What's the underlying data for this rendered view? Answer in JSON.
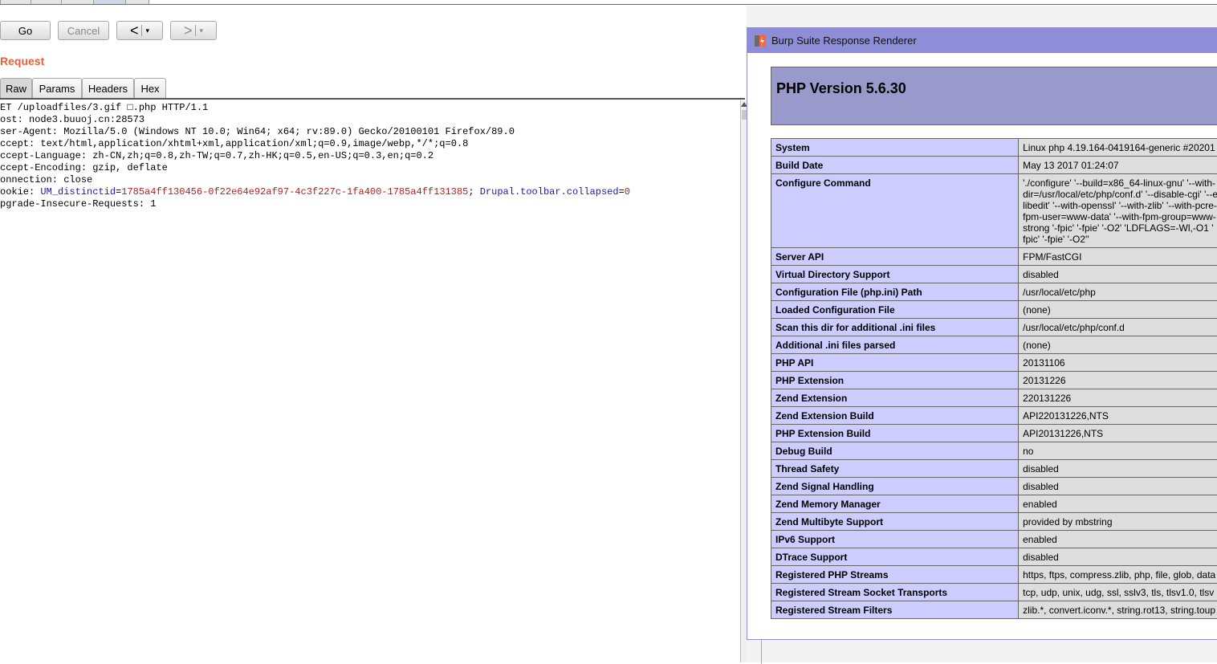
{
  "toolbar": {
    "go_label": "Go",
    "cancel_label": "Cancel",
    "back_arrow": "<",
    "forward_arrow": ">",
    "dropdown_glyph": "▾"
  },
  "request": {
    "title": "Request",
    "tabs": [
      "Raw",
      "Params",
      "Headers",
      "Hex"
    ],
    "active_tab": "Raw",
    "lines": [
      "ET /uploadfiles/3.gif □.php HTTP/1.1",
      "ost: node3.buuoj.cn:28573",
      "ser-Agent: Mozilla/5.0 (Windows NT 10.0; Win64; x64; rv:89.0) Gecko/20100101 Firefox/89.0",
      "ccept: text/html,application/xhtml+xml,application/xml;q=0.9,image/webp,*/*;q=0.8",
      "ccept-Language: zh-CN,zh;q=0.8,zh-TW;q=0.7,zh-HK;q=0.5,en-US;q=0.3,en;q=0.2",
      "ccept-Encoding: gzip, deflate",
      "onnection: close"
    ],
    "cookie_line": {
      "prefix": "ookie: ",
      "name1": "UM_distinctid",
      "eq1": "=",
      "value1": "1785a4ff130456-0f22e64e92af97-4c3f227c-1fa400-1785a4ff131385",
      "sep": "; ",
      "name2": "Drupal.toolbar.collapsed",
      "eq2": "=",
      "value2": "0"
    },
    "last_line": "pgrade-Insecure-Requests: 1"
  },
  "renderer": {
    "window_title": "Burp Suite Response Renderer",
    "php_version": "PHP Version 5.6.30",
    "rows": [
      {
        "key": "System",
        "value": "Linux php 4.19.164-0419164-generic #20201"
      },
      {
        "key": "Build Date",
        "value": "May 13 2017 01:24:07"
      },
      {
        "key": "Configure Command",
        "value": "'./configure' '--build=x86_64-linux-gnu' '--with-dir=/usr/local/etc/php/conf.d' '--disable-cgi' '--e libedit' '--with-openssl' '--with-zlib' '--with-pcre-fpm-user=www-data' '--with-fpm-group=www-strong '-fpic' '-fpie' '-O2' 'LDFLAGS=-Wl,-O1 ' fpic' '-fpie' '-O2''"
      },
      {
        "key": "Server API",
        "value": "FPM/FastCGI"
      },
      {
        "key": "Virtual Directory Support",
        "value": "disabled"
      },
      {
        "key": "Configuration File (php.ini) Path",
        "value": "/usr/local/etc/php"
      },
      {
        "key": "Loaded Configuration File",
        "value": "(none)"
      },
      {
        "key": "Scan this dir for additional .ini files",
        "value": "/usr/local/etc/php/conf.d"
      },
      {
        "key": "Additional .ini files parsed",
        "value": "(none)"
      },
      {
        "key": "PHP API",
        "value": "20131106"
      },
      {
        "key": "PHP Extension",
        "value": "20131226"
      },
      {
        "key": "Zend Extension",
        "value": "220131226"
      },
      {
        "key": "Zend Extension Build",
        "value": "API220131226,NTS"
      },
      {
        "key": "PHP Extension Build",
        "value": "API20131226,NTS"
      },
      {
        "key": "Debug Build",
        "value": "no"
      },
      {
        "key": "Thread Safety",
        "value": "disabled"
      },
      {
        "key": "Zend Signal Handling",
        "value": "disabled"
      },
      {
        "key": "Zend Memory Manager",
        "value": "enabled"
      },
      {
        "key": "Zend Multibyte Support",
        "value": "provided by mbstring"
      },
      {
        "key": "IPv6 Support",
        "value": "enabled"
      },
      {
        "key": "DTrace Support",
        "value": "disabled"
      },
      {
        "key": "Registered PHP Streams",
        "value": "https, ftps, compress.zlib, php, file, glob, data"
      },
      {
        "key": "Registered Stream Socket Transports",
        "value": "tcp, udp, unix, udg, ssl, sslv3, tls, tlsv1.0, tlsv"
      },
      {
        "key": "Registered Stream Filters",
        "value": "zlib.*, convert.iconv.*, string.rot13, string.toup"
      }
    ]
  },
  "colors": {
    "request_title": "#e8613b",
    "renderer_titlebar": "#8d8dd8",
    "php_header": "#9999cc",
    "key_cell": "#ccccff",
    "value_cell": "#dddddd"
  }
}
